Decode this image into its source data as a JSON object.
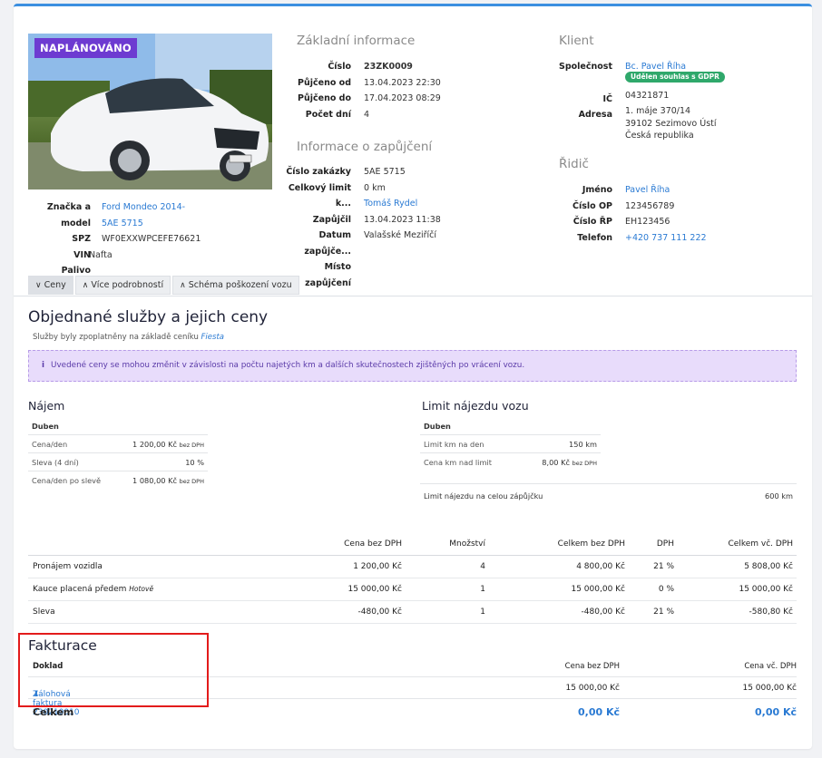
{
  "status_badge": "NAPLÁNOVÁNO",
  "vehicle": {
    "brand_model_label": "Značka a model",
    "brand_model": "Ford Mondeo 2014-",
    "spz_label": "SPZ",
    "spz": "5AE 5715",
    "vin_label": "VIN",
    "vin": "WF0EXXWPCEFE76621",
    "fuel_label": "Palivo",
    "fuel": "Nafta"
  },
  "basic": {
    "title": "Základní informace",
    "number_label": "Číslo",
    "number": "23ZK0009",
    "from_label": "Půjčeno od",
    "from": "13.04.2023 22:30",
    "to_label": "Půjčeno do",
    "to": "17.04.2023 08:29",
    "days_label": "Počet dní",
    "days": "4"
  },
  "loan": {
    "title": "Informace o zapůjčení",
    "order_label": "Číslo zakázky",
    "order": "5AE 5715",
    "limit_label": "Celkový limit k...",
    "limit": "0 km",
    "lent_by_label": "Zapůjčil",
    "lent_by": "Tomáš Rydel",
    "date_label": "Datum zapůjče...",
    "date": "13.04.2023 11:38",
    "place_label": "Místo zapůjčení",
    "place": "Valašské Meziříčí"
  },
  "client": {
    "title": "Klient",
    "company_label": "Společnost",
    "company": "Bc. Pavel Říha",
    "gdpr_badge": "Udělen souhlas s GDPR",
    "ic_label": "IČ",
    "ic": "04321871",
    "address_label": "Adresa",
    "address_line1": "1. máje 370/14",
    "address_line2": "39102 Sezimovo Ústí",
    "address_line3": "Česká republika"
  },
  "driver": {
    "title": "Řidič",
    "name_label": "Jméno",
    "name": "Pavel Říha",
    "op_label": "Číslo OP",
    "op": "123456789",
    "rp_label": "Číslo ŘP",
    "rp": "EH123456",
    "phone_label": "Telefon",
    "phone": "+420 737 111 222"
  },
  "tabs": [
    "Ceny",
    "Více podrobností",
    "Schéma poškození vozu"
  ],
  "services": {
    "title": "Objednané služby a jejich ceny",
    "subtitle": "Služby byly zpoplatněny na základě ceníku",
    "pricelist": "Fiesta",
    "alert": "Uvedené ceny se mohou změnit v závislosti na počtu najetých km a dalších skutečnostech zjištěných po vrácení vozu."
  },
  "rent": {
    "title": "Nájem",
    "month": "Duben",
    "rows": [
      {
        "label": "Cena/den",
        "value": "1 200,00 Kč",
        "note": "bez DPH"
      },
      {
        "label": "Sleva (4 dní)",
        "value": "10 %",
        "note": ""
      },
      {
        "label": "Cena/den po slevě",
        "value": "1 080,00 Kč",
        "note": "bez DPH"
      }
    ]
  },
  "mileage": {
    "title": "Limit nájezdu vozu",
    "month": "Duben",
    "rows": [
      {
        "label": "Limit km na den",
        "value": "150 km",
        "note": ""
      },
      {
        "label": "Cena km nad limit",
        "value": "8,00 Kč",
        "note": "bez DPH"
      }
    ],
    "total_label": "Limit nájezdu na celou zápůjčku",
    "total_value": "600 km"
  },
  "table": {
    "headers": [
      "",
      "Cena bez DPH",
      "Množství",
      "Celkem bez DPH",
      "DPH",
      "Celkem vč. DPH"
    ],
    "rows": [
      {
        "name": "Pronájem vozidla",
        "note": "",
        "price": "1 200,00 Kč",
        "qty": "4",
        "total": "4 800,00 Kč",
        "vat": "21 %",
        "total_vat": "5 808,00 Kč"
      },
      {
        "name": "Kauce placená předem",
        "note": "Hotově",
        "price": "15 000,00 Kč",
        "qty": "1",
        "total": "15 000,00 Kč",
        "vat": "0 %",
        "total_vat": "15 000,00 Kč"
      },
      {
        "name": "Sleva",
        "note": "",
        "price": "-480,00 Kč",
        "qty": "1",
        "total": "-480,00 Kč",
        "vat": "21 %",
        "total_vat": "-580,80 Kč"
      }
    ]
  },
  "billing": {
    "title": "Fakturace",
    "col_doc": "Doklad",
    "col_net": "Cena bez DPH",
    "col_gross": "Cena vč. DPH",
    "doc_name": "Zálohová faktura 230210010",
    "doc_net": "15 000,00 Kč",
    "doc_gross": "15 000,00 Kč",
    "total_label": "Celkem",
    "total_net": "0,00 Kč",
    "total_gross": "0,00 Kč"
  }
}
